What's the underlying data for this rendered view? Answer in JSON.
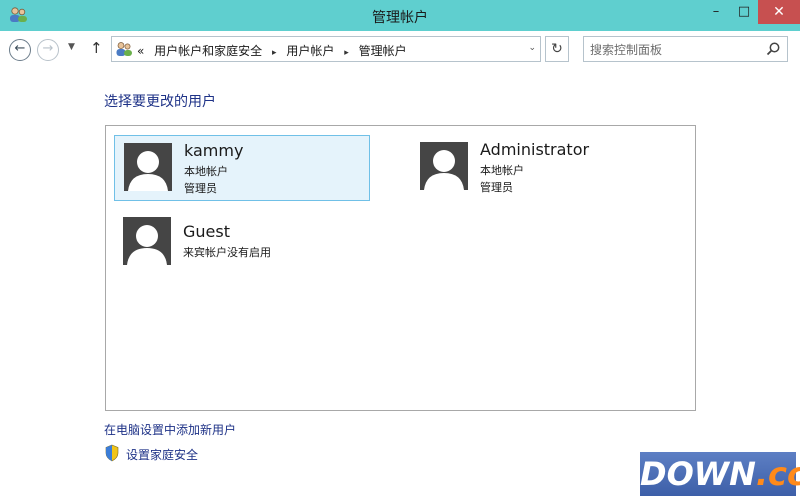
{
  "window": {
    "title": "管理帐户",
    "minimize_glyph": "–",
    "maximize_glyph": "□",
    "close_glyph": "✕"
  },
  "nav": {
    "back_glyph": "←",
    "forward_glyph": "→",
    "recent_glyph": "▼",
    "up_glyph": "↑",
    "refresh_glyph": "↻",
    "breadcrumb": {
      "overflow": "«",
      "items": [
        "用户帐户和家庭安全",
        "用户帐户",
        "管理帐户"
      ],
      "separator": "▸",
      "dropdown_glyph": "⌄"
    },
    "search_placeholder": "搜索控制面板"
  },
  "main": {
    "heading": "选择要更改的用户",
    "users": [
      {
        "name": "kammy",
        "detail1": "本地帐户",
        "detail2": "管理员",
        "selected": true
      },
      {
        "name": "Administrator",
        "detail1": "本地帐户",
        "detail2": "管理员",
        "selected": false
      },
      {
        "name": "Guest",
        "detail1": "来宾帐户没有启用",
        "detail2": "",
        "selected": false
      }
    ],
    "links": {
      "add_user": "在电脑设置中添加新用户",
      "family_safety": "设置家庭安全"
    }
  },
  "watermark": {
    "main": "DOWN",
    "suffix": ".cc"
  },
  "colors": {
    "titlebar": "#5fcfcf",
    "close_button": "#c75050",
    "selected_bg": "#e5f3fb",
    "selected_border": "#70c0e7",
    "link": "#1e3287"
  }
}
